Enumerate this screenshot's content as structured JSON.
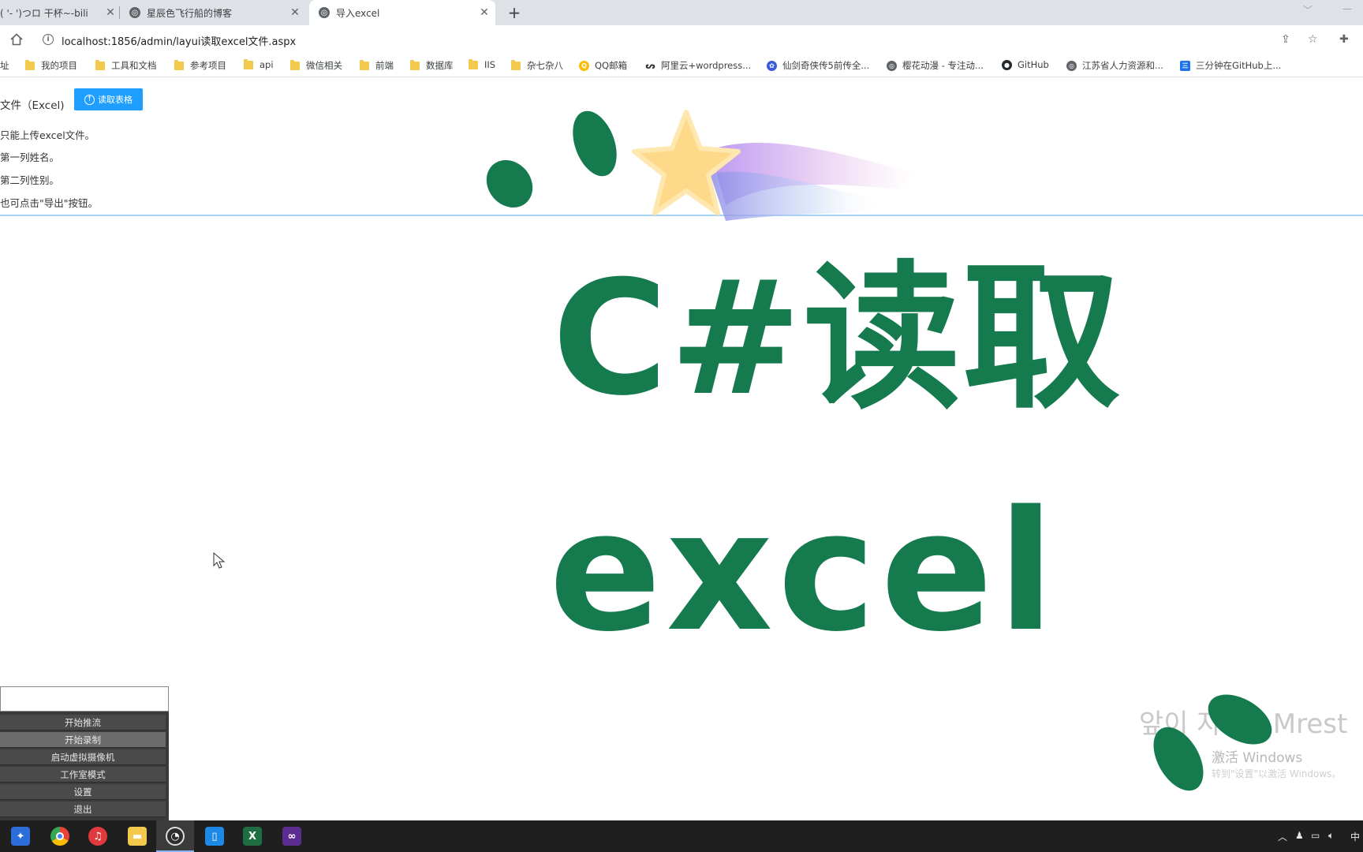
{
  "browser": {
    "tabs": [
      {
        "title": "( '- ')つロ 干杯~-bili",
        "active": false
      },
      {
        "title": "星辰色飞行船的博客",
        "active": false
      },
      {
        "title": "导入excel",
        "active": true
      }
    ],
    "new_tab_symbol": "+",
    "url": "localhost:1856/admin/layui读取excel文件.aspx",
    "bookmarks": [
      {
        "label": "址",
        "icon": "folder-icon"
      },
      {
        "label": "我的项目",
        "icon": "folder-icon"
      },
      {
        "label": "工具和文档",
        "icon": "folder-icon"
      },
      {
        "label": "参考项目",
        "icon": "folder-icon"
      },
      {
        "label": "api",
        "icon": "folder-icon"
      },
      {
        "label": "微信相关",
        "icon": "folder-icon"
      },
      {
        "label": "前端",
        "icon": "folder-icon"
      },
      {
        "label": "数据库",
        "icon": "folder-icon"
      },
      {
        "label": "IIS",
        "icon": "folder-icon"
      },
      {
        "label": "杂七杂八",
        "icon": "folder-icon"
      },
      {
        "label": "QQ邮箱",
        "icon": "qq-mail-icon"
      },
      {
        "label": "阿里云+wordpress...",
        "icon": "aliyun-icon"
      },
      {
        "label": "仙剑奇侠传5前传全...",
        "icon": "paw-icon"
      },
      {
        "label": "樱花动漫 - 专注动...",
        "icon": "globe-icon"
      },
      {
        "label": "GitHub",
        "icon": "github-icon"
      },
      {
        "label": "江苏省人力资源和...",
        "icon": "globe-icon"
      },
      {
        "label": "三分钟在GitHub上...",
        "icon": "blue-square-icon"
      }
    ]
  },
  "page": {
    "file_label": "文件（Excel)",
    "read_button": "读取表格",
    "hints": [
      "只能上传excel文件。",
      "第一列姓名。",
      "第二列性别。",
      "也可点击\"导出\"按钮。"
    ]
  },
  "overlay": {
    "line1": "C#读取",
    "line2": "excel",
    "color": "#157a4e"
  },
  "obs_menu": {
    "items": [
      "开始推流",
      "开始录制",
      "启动虚拟摄像机",
      "工作室模式",
      "设置",
      "退出"
    ],
    "selected_index": 1
  },
  "watermark": {
    "text": "앞이 자리 - Mrest",
    "activate_title": "激活 Windows",
    "activate_sub": "转到\"设置\"以激活 Windows。"
  },
  "taskbar": {
    "ime": "中"
  }
}
